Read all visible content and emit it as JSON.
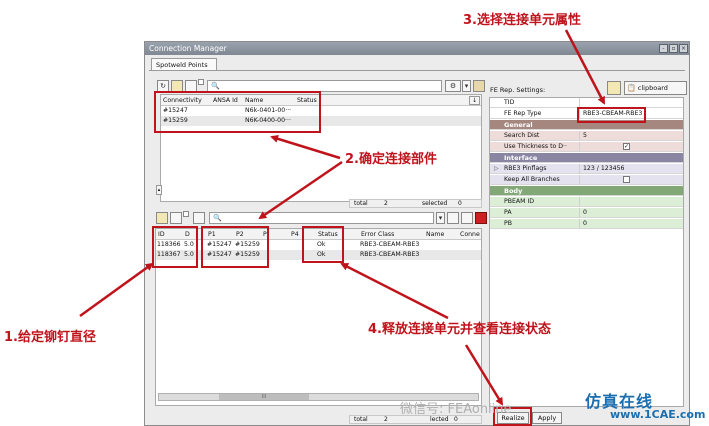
{
  "window": {
    "title": "Connection Manager",
    "tab": "Spotweld Points",
    "close_glyph": "×",
    "restore_glyph": "▫",
    "minimize_glyph": "-"
  },
  "icons": {
    "refresh": "↻",
    "search": "🔍",
    "gear": "⚙",
    "dropdown": "▾",
    "scroll_down": "↓",
    "scroll_up": "▲",
    "scroll_up_small": "▴",
    "clipboard_glyph": "📋"
  },
  "colors": {
    "annotation": "#c0141c",
    "section_general": "#a5877f",
    "section_interface": "#8a85a3",
    "section_body": "#83a877",
    "row_general": "#eddcd9",
    "row_interface": "#e4e2ee",
    "row_body": "#dcefd6"
  },
  "top_table": {
    "columns": [
      "Connectivity",
      "ANSA Id",
      "Name",
      "Status"
    ],
    "rows": [
      {
        "connectivity": "#15247",
        "ansa_id": "",
        "name": "N6k-0401-00···",
        "status": ""
      },
      {
        "connectivity": "#15259",
        "ansa_id": "",
        "name": "N6K-0400-00···",
        "status": ""
      }
    ],
    "footer_total_label": "total",
    "footer_total_value": "2",
    "footer_selected_label": "selected",
    "footer_selected_value": "0"
  },
  "bottom_table": {
    "columns": [
      "ID",
      "D",
      "P1",
      "P2",
      "P",
      "P4",
      "Status",
      "Error Class",
      "Name",
      "Conne"
    ],
    "rows": [
      {
        "id": "118366",
        "d": "5.0",
        "p1": "#15247",
        "p2": "#15259",
        "status": "Ok",
        "error_class": "RBE3-CBEAM-RBE3"
      },
      {
        "id": "118367",
        "d": "5.0",
        "p1": "#15247",
        "p2": "#15259",
        "status": "Ok",
        "error_class": "RBE3-CBEAM-RBE3"
      }
    ],
    "footer_total_label": "total",
    "footer_total_value": "2",
    "footer_selected_label": "lected",
    "footer_selected_value": "0",
    "scroll_label": "III"
  },
  "settings": {
    "title": "FE Rep. Settings:",
    "clipboard_label": "clipboard",
    "rows": [
      {
        "key": "TID",
        "value": ""
      },
      {
        "key": "FE Rep Type",
        "value": "RBE3-CBEAM-RBE3"
      }
    ],
    "section_general": "General",
    "general_rows": [
      {
        "key": "Search Dist",
        "value": "5"
      },
      {
        "key": "Use Thickness to D··",
        "value": "✓"
      }
    ],
    "section_interface": "Interface",
    "interface_rows": [
      {
        "key": "RBE3 Pinflags",
        "value": "123 / 123456"
      },
      {
        "key": "Keep All Branches",
        "value": ""
      }
    ],
    "section_body": "Body",
    "body_rows": [
      {
        "key": "PBEAM ID",
        "value": ""
      },
      {
        "key": "PA",
        "value": "0"
      },
      {
        "key": "PB",
        "value": "0"
      }
    ]
  },
  "buttons": {
    "realize": "Realize",
    "apply": "Apply"
  },
  "annotations": {
    "a1": "1.给定铆钉直径",
    "a2": "2.确定连接部件",
    "a3": "3.选择连接单元属性",
    "a4": "4.释放连接单元并查看连接状态"
  },
  "watermark": {
    "wechat": "微信号: FEAonline",
    "brand": "仿真在线",
    "site": "www.1CAE.com"
  }
}
